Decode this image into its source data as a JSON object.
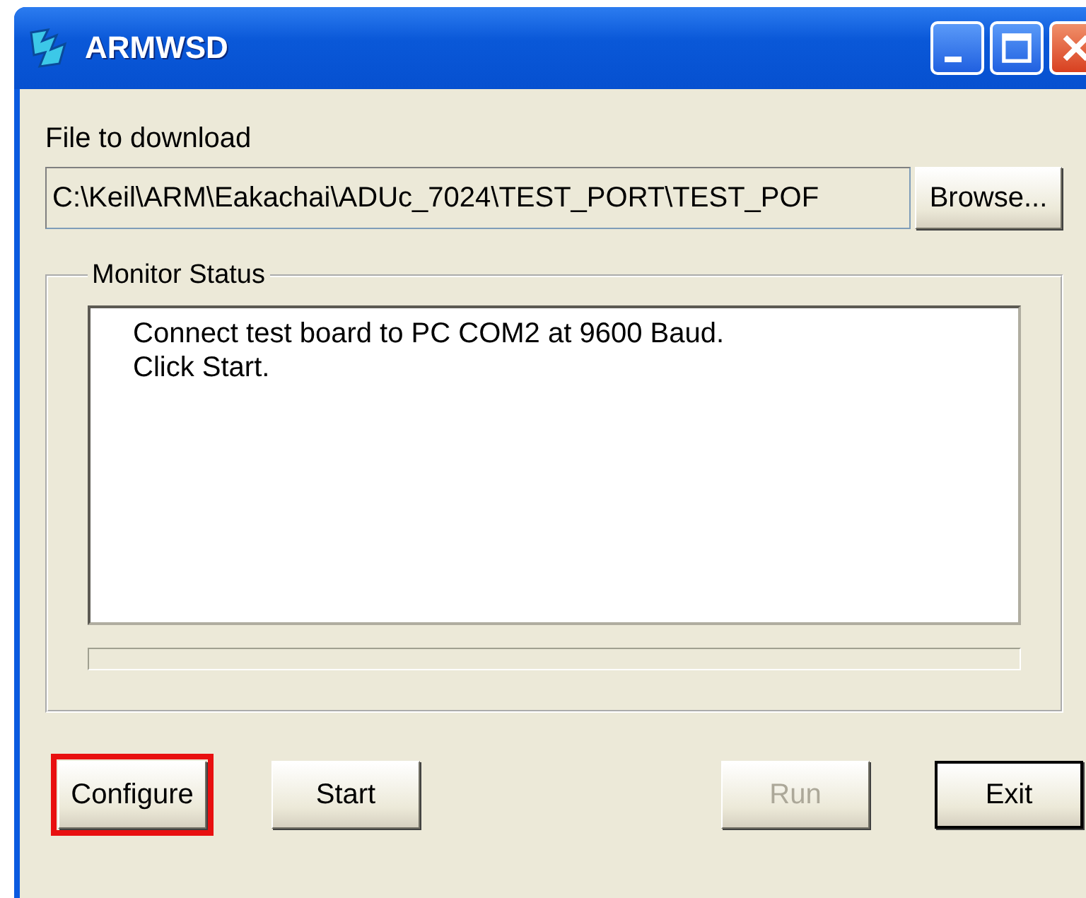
{
  "window": {
    "title": "ARMWSD"
  },
  "file_label": "File to download",
  "file_path": {
    "value": "C:\\Keil\\ARM\\Eakachai\\ADUc_7024\\TEST_PORT\\TEST_POF"
  },
  "browse_button": "Browse...",
  "monitor": {
    "title": "Monitor Status",
    "lines": [
      "Connect test board to PC COM2 at 9600 Baud.",
      "Click Start."
    ]
  },
  "buttons": [
    {
      "label": "Configure",
      "disabled": false,
      "default": false,
      "highlighted": true
    },
    {
      "label": "Start",
      "disabled": false,
      "default": false,
      "highlighted": false
    },
    {
      "label": "Run",
      "disabled": true,
      "default": false,
      "highlighted": false
    },
    {
      "label": "Exit",
      "disabled": false,
      "default": true,
      "highlighted": false
    }
  ]
}
